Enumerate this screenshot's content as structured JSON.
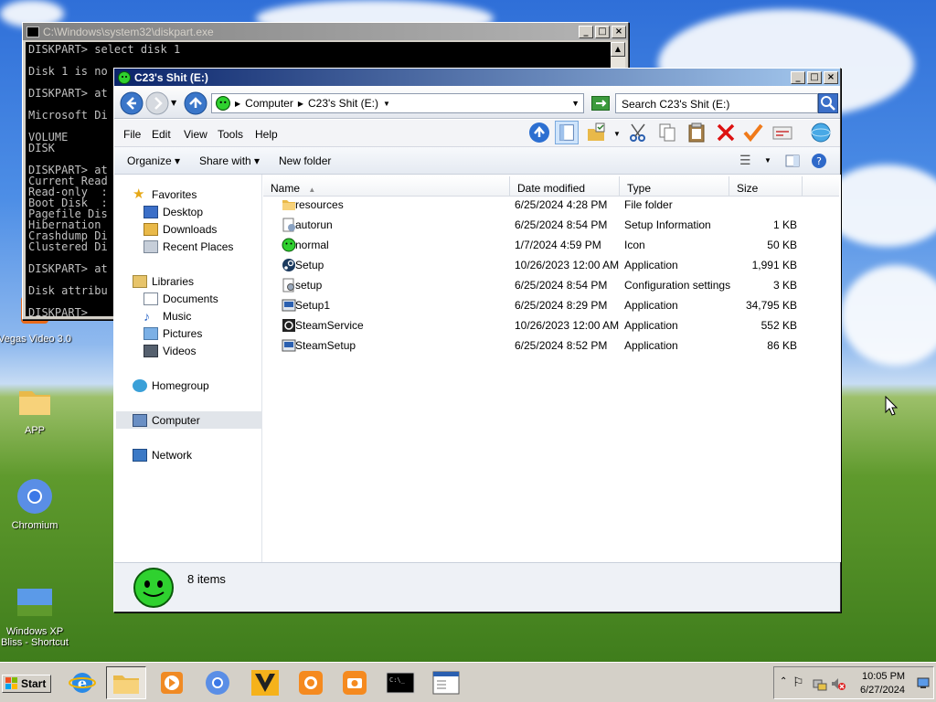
{
  "console": {
    "title": "C:\\Windows\\system32\\diskpart.exe",
    "lines": [
      "DISKPART> select disk 1",
      "",
      "Disk 1 is no",
      "",
      "DISKPART> at",
      "",
      "Microsoft Di",
      "",
      "VOLUME",
      "DISK",
      "",
      "DISKPART> at",
      "Current Read",
      "Read-only  :",
      "Boot Disk  :",
      "Pagefile Dis",
      "Hibernation",
      "Crashdump Di",
      "Clustered Di",
      "",
      "DISKPART> at",
      "",
      "Disk attribu",
      "",
      "DISKPART>"
    ]
  },
  "explorer": {
    "title": "C23's Shit (E:)",
    "address": {
      "root": "Computer",
      "current": "C23's Shit (E:)"
    },
    "search_placeholder": "Search C23's Shit (E:)",
    "menu": [
      "File",
      "Edit",
      "View",
      "Tools",
      "Help"
    ],
    "commands": {
      "organize": "Organize",
      "share_with": "Share with",
      "new_folder": "New folder"
    },
    "nav": {
      "favorites": "Favorites",
      "desktop": "Desktop",
      "downloads": "Downloads",
      "recent": "Recent Places",
      "libraries": "Libraries",
      "documents": "Documents",
      "music": "Music",
      "pictures": "Pictures",
      "videos": "Videos",
      "homegroup": "Homegroup",
      "computer": "Computer",
      "network": "Network"
    },
    "columns": {
      "name": "Name",
      "date": "Date modified",
      "type": "Type",
      "size": "Size"
    },
    "files": [
      {
        "name": "resources",
        "date": "6/25/2024 4:28 PM",
        "type": "File folder",
        "size": "",
        "icon": "folder-icon"
      },
      {
        "name": "autorun",
        "date": "6/25/2024 8:54 PM",
        "type": "Setup Information",
        "size": "1 KB",
        "icon": "setup-info-icon"
      },
      {
        "name": "normal",
        "date": "1/7/2024 4:59 PM",
        "type": "Icon",
        "size": "50 KB",
        "icon": "smiley-icon"
      },
      {
        "name": "Setup",
        "date": "10/26/2023 12:00 AM",
        "type": "Application",
        "size": "1,991 KB",
        "icon": "steam-icon"
      },
      {
        "name": "setup",
        "date": "6/25/2024 8:54 PM",
        "type": "Configuration settings",
        "size": "3 KB",
        "icon": "config-icon"
      },
      {
        "name": "Setup1",
        "date": "6/25/2024 8:29 PM",
        "type": "Application",
        "size": "34,795 KB",
        "icon": "installer-icon"
      },
      {
        "name": "SteamService",
        "date": "10/26/2023 12:00 AM",
        "type": "Application",
        "size": "552 KB",
        "icon": "steam-service-icon"
      },
      {
        "name": "SteamSetup",
        "date": "6/25/2024 8:52 PM",
        "type": "Application",
        "size": "86 KB",
        "icon": "installer-icon"
      }
    ],
    "status": "8 items"
  },
  "desktop_icons": {
    "vegas": "Vegas Video 3.0",
    "app": "APP",
    "chromium": "Chromium",
    "bliss": "Windows XP Bliss - Shortcut"
  },
  "taskbar": {
    "start": "Start",
    "time": "10:05 PM",
    "date": "6/27/2024"
  },
  "colors": {
    "title_active": "#0a246a",
    "title_inactive": "#808080",
    "face": "#d4d0c8"
  }
}
